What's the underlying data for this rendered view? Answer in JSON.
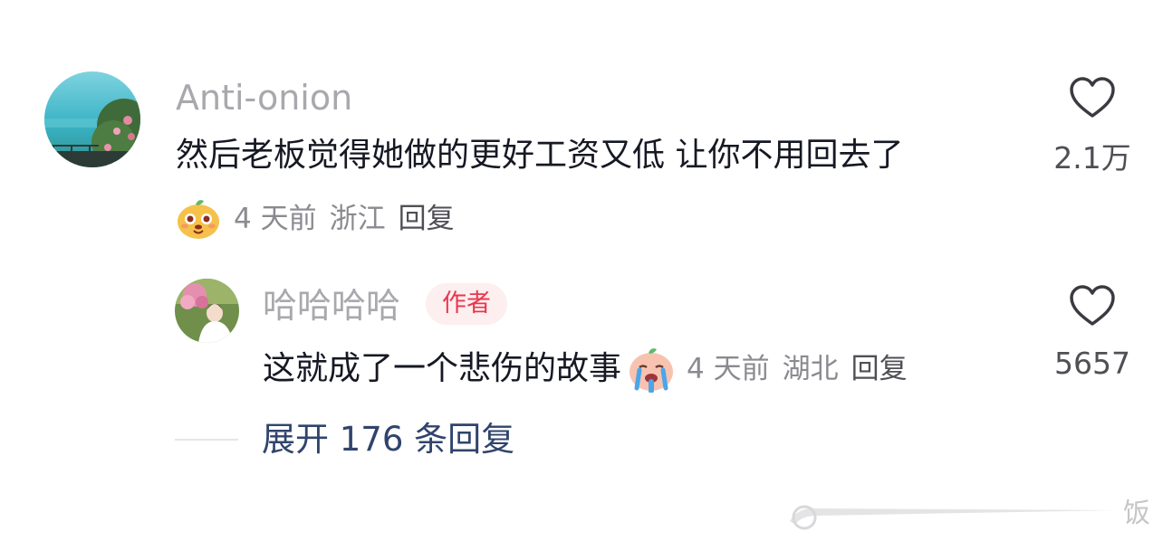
{
  "comment": {
    "username": "Anti-onion",
    "text": "然后老板觉得她做的更好工资又低 让你不用回去了",
    "time": "4 天前",
    "location": "浙江",
    "reply_label": "回复",
    "like_count": "2.1万",
    "sticker_icon": "dog-sticker-icon"
  },
  "reply": {
    "username": "哈哈哈哈",
    "badge": "作者",
    "text": "这就成了一个悲伤的故事",
    "time": "4 天前",
    "location": "湖北",
    "reply_label": "回复",
    "like_count": "5657",
    "emoji_icon": "crying-face-icon"
  },
  "expand": {
    "label": "展开 176 条回复"
  },
  "watermark": {
    "text": "饭"
  },
  "colors": {
    "username": "#a8a8ad",
    "badge_text": "#e9374c",
    "badge_bg": "#fdeef0",
    "expand_link": "#30446c"
  }
}
